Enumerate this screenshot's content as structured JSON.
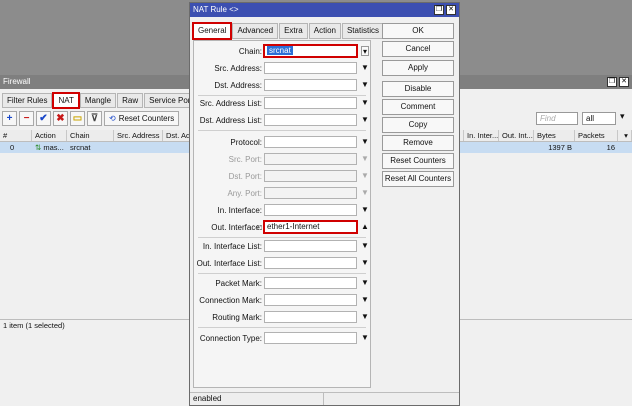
{
  "firewall": {
    "title": "Firewall",
    "tabs": [
      "Filter Rules",
      "NAT",
      "Mangle",
      "Raw",
      "Service Ports"
    ],
    "toolbar": {
      "reset_counters": "Reset Counters"
    },
    "find_placeholder": "Find",
    "filter_value": "all",
    "columns": [
      "#",
      "Action",
      "Chain",
      "Src. Address",
      "Dst. Ad",
      "In. Inter...",
      "Out. Int...",
      "Bytes",
      "Packets"
    ],
    "rows": [
      {
        "num": "0",
        "action": "mas...",
        "chain": "srcnat",
        "bytes": "1397 B",
        "packets": "16"
      }
    ],
    "status": "1 item (1 selected)"
  },
  "dialog": {
    "title": "NAT Rule <>",
    "tabs": [
      "General",
      "Advanced",
      "Extra",
      "Action",
      "Statistics"
    ],
    "fields": {
      "chain": {
        "label": "Chain:",
        "value": "srcnat"
      },
      "src_address": "Src. Address:",
      "dst_address": "Dst. Address:",
      "src_address_list": "Src. Address List:",
      "dst_address_list": "Dst. Address List:",
      "protocol": "Protocol:",
      "src_port": "Src. Port:",
      "dst_port": "Dst. Port:",
      "any_port": "Any. Port:",
      "in_interface": "In. Interface:",
      "out_interface": {
        "label": "Out. Interface:",
        "value": "ether1-Internet"
      },
      "in_interface_list": "In. Interface List:",
      "out_interface_list": "Out. Interface List:",
      "packet_mark": "Packet Mark:",
      "connection_mark": "Connection Mark:",
      "routing_mark": "Routing Mark:",
      "connection_type": "Connection Type:"
    },
    "buttons": [
      "OK",
      "Cancel",
      "Apply",
      "Disable",
      "Comment",
      "Copy",
      "Remove",
      "Reset Counters",
      "Reset All Counters"
    ],
    "status": "enabled"
  },
  "colors": {
    "titlebar_active": "#3c4fb1",
    "selection": "#c7dcf2",
    "highlight_box": "#d00000"
  }
}
